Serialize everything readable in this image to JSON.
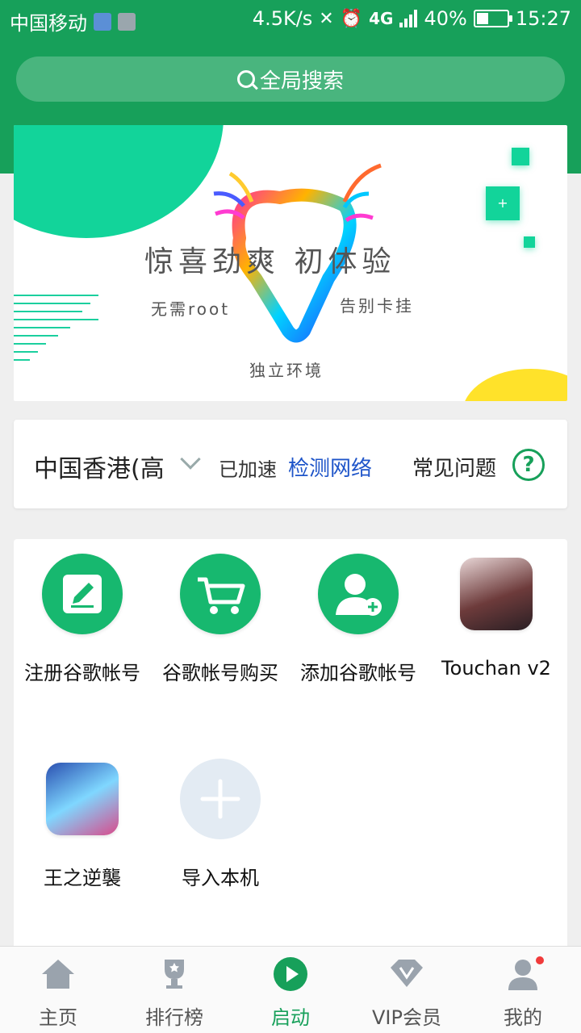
{
  "status": {
    "carrier": "中国移动",
    "speed": "4.5K/s",
    "network": "4G",
    "battery": "40%",
    "battery_level": 0.4,
    "time": "15:27"
  },
  "search": {
    "placeholder": "全局搜索"
  },
  "banner": {
    "title": "惊喜劲爽  初体验",
    "left_sub": "无需root",
    "right_sub": "告别卡挂",
    "bottom_sub": "独立环境"
  },
  "network": {
    "region": "中国香港(高",
    "status": "已加速",
    "check": "检测网络",
    "faq": "常见问题"
  },
  "apps": [
    {
      "label": "注册谷歌帐号"
    },
    {
      "label": "谷歌帐号购买"
    },
    {
      "label": "添加谷歌帐号"
    },
    {
      "label": "Touchan v2"
    },
    {
      "label": "王之逆襲"
    },
    {
      "label": "导入本机"
    }
  ],
  "nav": [
    {
      "label": "主页"
    },
    {
      "label": "排行榜"
    },
    {
      "label": "启动"
    },
    {
      "label": "VIP会员"
    },
    {
      "label": "我的"
    }
  ],
  "colors": {
    "brand": "#17a05a",
    "accent": "#12d49a",
    "link": "#1f55c9"
  }
}
